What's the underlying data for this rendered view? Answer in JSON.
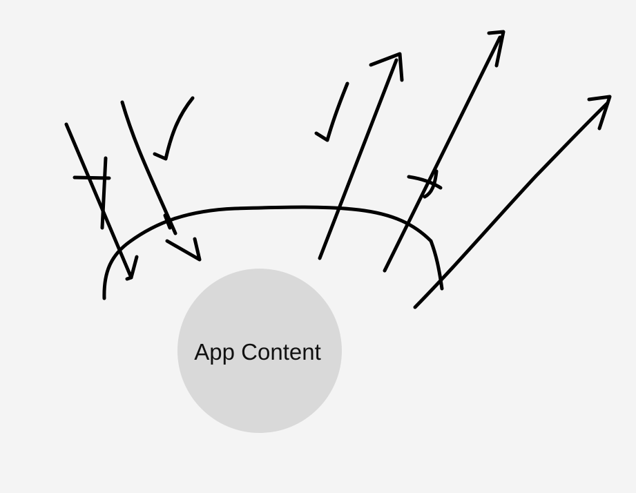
{
  "diagram": {
    "center_label": "App Content",
    "colors": {
      "background": "#f4f4f4",
      "circle_fill": "#d9d9d9",
      "ink": "#000000",
      "text": "#111111"
    },
    "marks": {
      "incoming_blocked": "crossed-arrow",
      "incoming_allowed": "checked-arrow",
      "outgoing_allowed": "checked-arrow",
      "outgoing_blocked": "crossed-arrow",
      "outgoing_unmarked": "arrow"
    }
  }
}
